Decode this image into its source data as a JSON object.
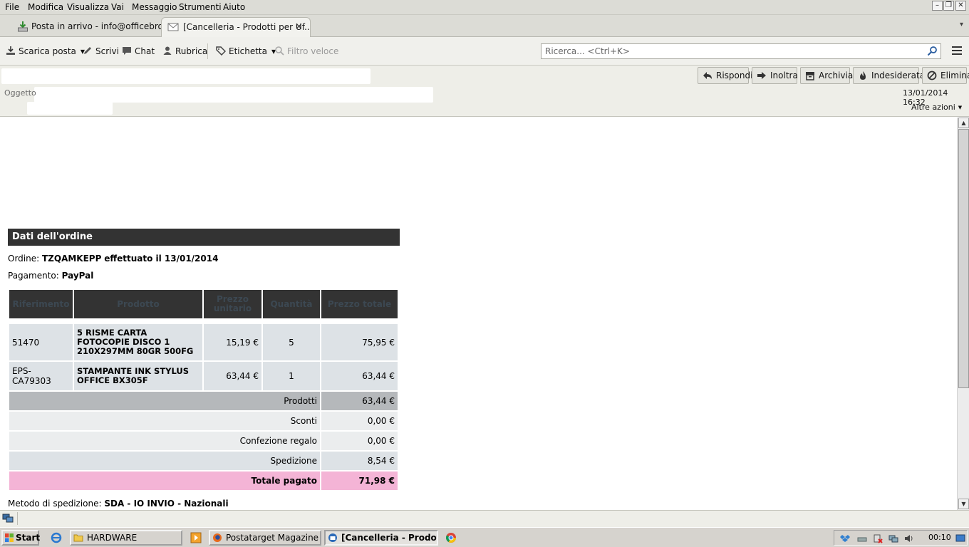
{
  "menu": {
    "items": [
      "File",
      "Modifica",
      "Visualizza",
      "Vai",
      "Messaggio",
      "Strumenti",
      "Aiuto"
    ]
  },
  "tabs": [
    {
      "label": "Posta in arrivo - info@officebro...",
      "icon": "inbox-download-icon"
    },
    {
      "label": "[Cancelleria - Prodotti per Uf...",
      "icon": "envelope-icon",
      "close": "×"
    }
  ],
  "toolbar": {
    "get_mail": "Scarica posta",
    "write": "Scrivi",
    "chat": "Chat",
    "address_book": "Rubrica",
    "tag": "Etichetta",
    "quick_filter": "Filtro veloce",
    "search_placeholder": "Ricerca... <Ctrl+K>"
  },
  "header": {
    "buttons": {
      "reply": "Rispondi",
      "forward": "Inoltra",
      "archive": "Archivia",
      "junk": "Indesiderata",
      "delete": "Elimina"
    },
    "subject_label": "Oggetto",
    "date": "13/01/2014 16:32",
    "more_actions": "Altre azioni"
  },
  "order": {
    "section_title": "Dati dell'ordine",
    "order_prefix": "Ordine:",
    "order_id": "TZQAMKEPP",
    "order_date_text": "effettuato il 13/01/2014",
    "payment_prefix": "Pagamento:",
    "payment_method": "PayPal",
    "columns": [
      "Riferimento",
      "Prodotto",
      "Prezzo unitario",
      "Quantità",
      "Prezzo totale"
    ],
    "rows": [
      {
        "ref": "51470",
        "product": "5 RISME CARTA FOTOCOPIE DISCO 1 210X297MM 80GR 500FG",
        "unit_price": "15,19 €",
        "qty": "5",
        "total": "75,95 €"
      },
      {
        "ref": "EPS-CA79303",
        "product": "STAMPANTE INK STYLUS OFFICE BX305F",
        "unit_price": "63,44 €",
        "qty": "1",
        "total": "63,44 €"
      }
    ],
    "summary": {
      "products_label": "Prodotti",
      "products_value": "63,44 €",
      "discounts_label": "Sconti",
      "discounts_value": "0,00 €",
      "gift_label": "Confezione regalo",
      "gift_value": "0,00 €",
      "shipping_label": "Spedizione",
      "shipping_value": "8,54 €",
      "total_label": "Totale pagato",
      "total_value": "71,98 €"
    },
    "shipping_method_prefix": "Metodo di spedizione:",
    "shipping_method": "SDA - IO INVIO - Nazionali"
  },
  "taskbar": {
    "start": "Start",
    "tasks": [
      "HARDWARE",
      "Postatarget Magazine - ...",
      "[Cancelleria - Prodott..."
    ],
    "clock": "00:10"
  },
  "colors": {
    "section_header": "#333333",
    "cell_bg": "#dde2e6",
    "total_row": "#f4b4d6",
    "products_row": "#b5b8bb"
  }
}
